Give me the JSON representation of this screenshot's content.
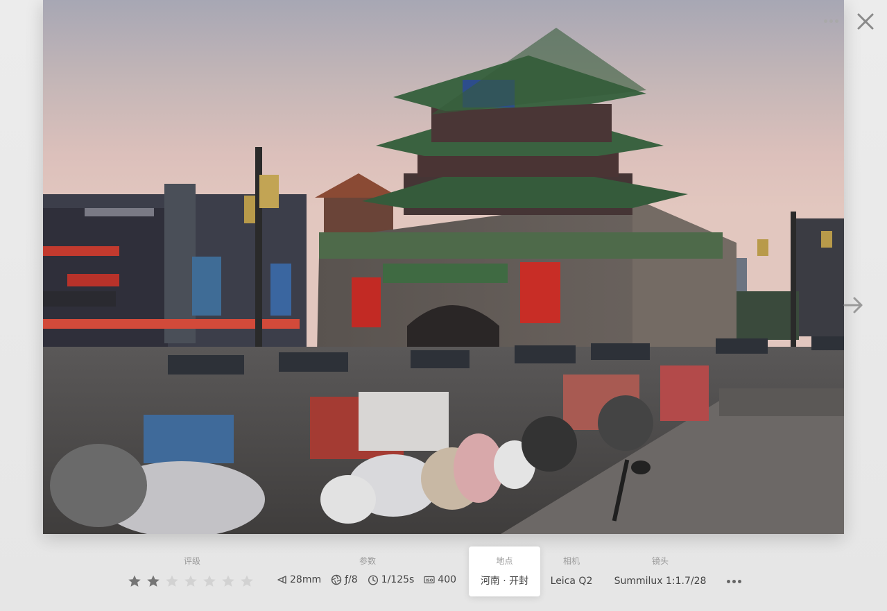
{
  "info": {
    "rating": {
      "label": "评级",
      "value": 2,
      "max": 7
    },
    "params": {
      "label": "参数",
      "focal_length": "28mm",
      "aperture": "ƒ/8",
      "shutter": "1/125s",
      "iso": "400"
    },
    "location": {
      "label": "地点",
      "value": "河南 · 开封"
    },
    "camera": {
      "label": "相机",
      "value": "Leica Q2"
    },
    "lens": {
      "label": "镜头",
      "value": "Summilux 1:1.7/28"
    }
  },
  "icons": {
    "top_more": "more-horizontal-icon",
    "close": "close-icon",
    "next": "arrow-right-icon",
    "focal": "focal-length-icon",
    "aperture": "aperture-icon",
    "shutter": "shutter-timer-icon",
    "iso": "iso-icon",
    "bottom_more": "more-horizontal-icon"
  },
  "colors": {
    "star_filled": "#757575",
    "star_empty": "#d2d2d2",
    "highlight_bg": "#ffffff"
  }
}
